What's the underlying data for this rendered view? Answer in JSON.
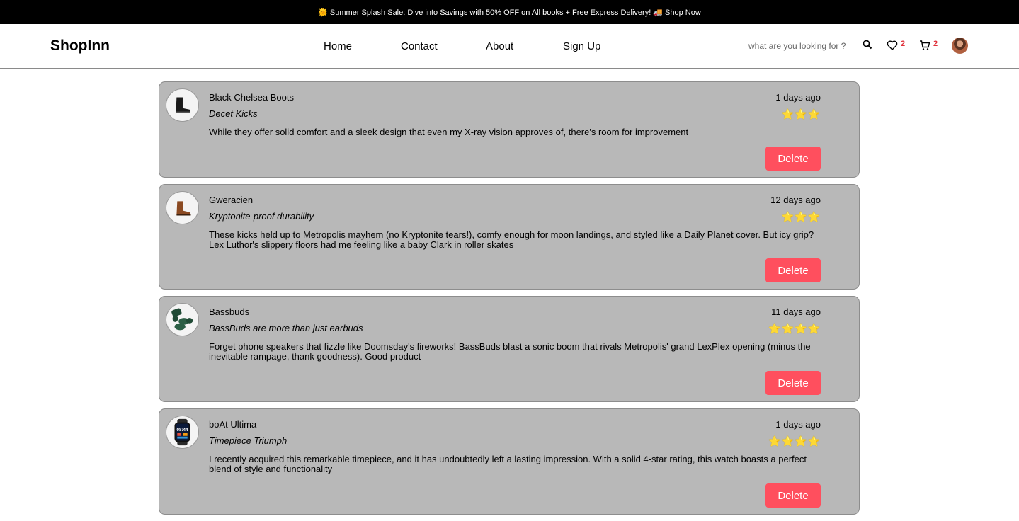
{
  "announcement": "🌞 Summer Splash Sale: Dive into Savings with 50% OFF on All books + Free Express Delivery! 🚚 Shop Now",
  "brand": "ShopInn",
  "nav": [
    {
      "label": "Home"
    },
    {
      "label": "Contact"
    },
    {
      "label": "About"
    },
    {
      "label": "Sign Up"
    }
  ],
  "search": {
    "placeholder": "what are you looking for ?"
  },
  "wishlist_count": "2",
  "cart_count": "2",
  "icons": {
    "search": "search-icon",
    "wishlist": "heart-icon",
    "cart": "cart-icon",
    "avatar": "user-avatar"
  },
  "colors": {
    "topbar": "#000000",
    "card_bg": "#b8b8b8",
    "delete_button": "#ff4f5e",
    "badge": "#e0303a",
    "star": "#f5c518"
  },
  "reviews": [
    {
      "product": "Black Chelsea Boots",
      "title": "Decet Kicks",
      "date": "1 days ago",
      "rating": 3,
      "stars": "⭐⭐⭐",
      "text": "While they offer solid comfort and a sleek design that even my X-ray vision approves of, there's room for improvement",
      "delete_label": "Delete",
      "image": "black-chelsea-boot"
    },
    {
      "product": "Gweracien",
      "title": "Kryptonite-proof durability",
      "date": "12 days ago",
      "rating": 3,
      "stars": "⭐⭐⭐",
      "text": "These kicks held up to Metropolis mayhem (no Kryptonite tears!), comfy enough for moon landings, and styled like a Daily Planet cover. But icy grip? Lex Luthor's slippery floors had me feeling like a baby Clark in roller skates",
      "delete_label": "Delete",
      "image": "brown-boot"
    },
    {
      "product": "Bassbuds",
      "title": "BassBuds are more than just earbuds",
      "date": "11 days ago",
      "rating": 4,
      "stars": "⭐⭐⭐⭐",
      "text": "Forget phone speakers that fizzle like Doomsday's fireworks! BassBuds blast a sonic boom that rivals Metropolis' grand LexPlex opening (minus the inevitable rampage, thank goodness). Good product",
      "delete_label": "Delete",
      "image": "green-earbuds"
    },
    {
      "product": "boAt Ultima",
      "title": "Timepiece Triumph",
      "date": "1 days ago",
      "rating": 4,
      "stars": "⭐⭐⭐⭐",
      "text": "I recently acquired this remarkable timepiece, and it has undoubtedly left a lasting impression. With a solid 4-star rating, this watch boasts a perfect blend of style and functionality",
      "delete_label": "Delete",
      "image": "smartwatch",
      "watch_face": "08:44"
    }
  ]
}
